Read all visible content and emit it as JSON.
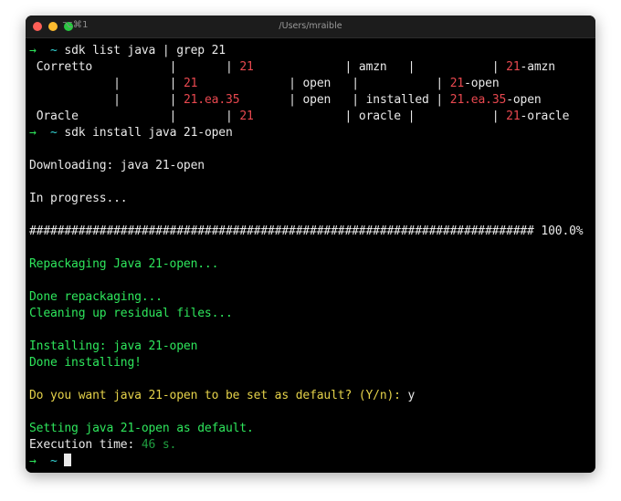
{
  "window": {
    "title": "/Users/mraible",
    "tab_label": "⌥⌘1",
    "traffic_lights": [
      "close-button",
      "minimize-button",
      "maximize-button"
    ]
  },
  "terminal": {
    "prompt_arrow": "→",
    "prompt_path": "~",
    "commands": {
      "first": "sdk list java | grep 21",
      "second": "sdk install java 21-open"
    },
    "table": {
      "rows": [
        {
          "vendor": "Corretto",
          "sep1": "|",
          "sep2": "|",
          "version": "21",
          "sep3": "|",
          "dist": "amzn",
          "sep4": "|",
          "status": "",
          "sep5": "|",
          "identifier_version": "21",
          "identifier_suffix": "-amzn"
        },
        {
          "vendor": "",
          "sep1": "|",
          "sep2": "|",
          "version": "21",
          "sep3": "|",
          "dist": "open",
          "sep4": "|",
          "status": "",
          "sep5": "|",
          "identifier_version": "21",
          "identifier_suffix": "-open"
        },
        {
          "vendor": "",
          "sep1": "|",
          "sep2": "|",
          "version": "21.ea.35",
          "sep3": "|",
          "dist": "open",
          "sep4": "|",
          "status": "installed",
          "sep5": "|",
          "identifier_version": "21.ea.35",
          "identifier_suffix": "-open"
        },
        {
          "vendor": "Oracle",
          "sep1": "|",
          "sep2": "|",
          "version": "21",
          "sep3": "|",
          "dist": "oracle",
          "sep4": "|",
          "status": "",
          "sep5": "|",
          "identifier_version": "21",
          "identifier_suffix": "-oracle"
        }
      ]
    },
    "output": {
      "downloading": "Downloading: java 21-open",
      "in_progress": "In progress...",
      "progress_hashes": "########################################################################",
      "progress_percent": "100.0%",
      "repackaging": "Repackaging Java 21-open...",
      "done_repackaging": "Done repackaging...",
      "cleaning": "Cleaning up residual files...",
      "installing": "Installing: java 21-open",
      "done_installing": "Done installing!",
      "default_question": "Do you want java 21-open to be set as default? (Y/n): ",
      "default_answer": "y",
      "setting_default": "Setting java 21-open as default.",
      "execution_label": "Execution time: ",
      "execution_value": "46 s."
    }
  },
  "colors": {
    "background": "#000000",
    "titlebar": "#1c1c1c",
    "foreground": "#e9e9e9",
    "green": "#2ee65c",
    "dim_green": "#1f9e3f",
    "cyan": "#34d6d6",
    "red": "#e8484f",
    "yellow": "#e5d24a"
  }
}
